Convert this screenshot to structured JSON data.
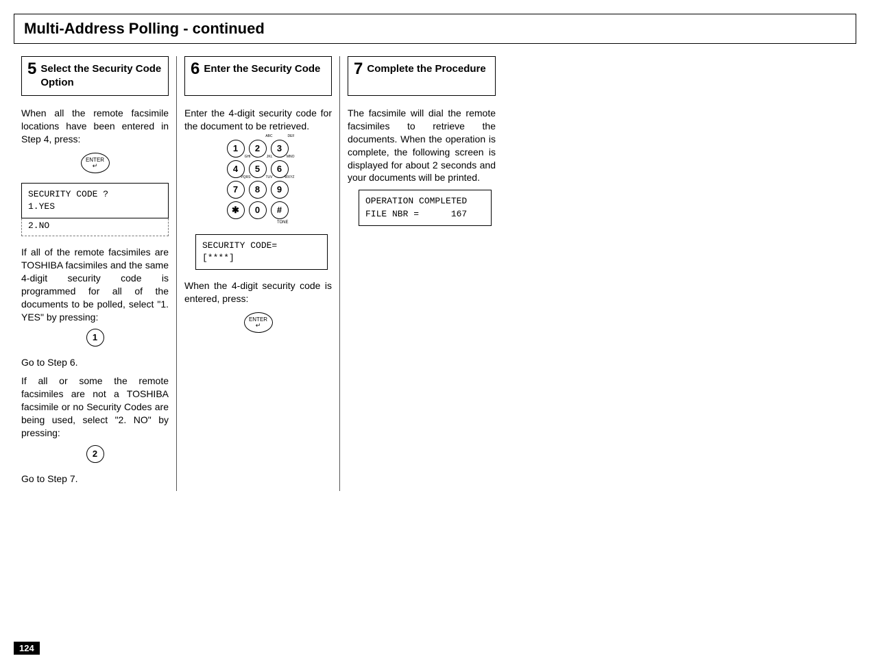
{
  "page_title": "Multi-Address Polling - continued",
  "page_number": "124",
  "step5": {
    "num": "5",
    "title": "Select the Security Code Option",
    "para1": "When all the remote facsimile locations have been entered in Step 4, press:",
    "enter_label": "ENTER",
    "screen1_line1": "SECURITY CODE ?",
    "screen1_line2": "1.YES",
    "screen1_line3": "2.NO",
    "para2": "If all of the remote facsimiles are TOSHIBA facsimiles and the same 4-digit security code is programmed for all of the documents to be polled, select \"1. YES\" by pressing:",
    "key_yes": "1",
    "para3": "Go to Step 6.",
    "para4": "If all or some the remote facsimiles are not a TOSHIBA facsimile or no Security Codes are being used, select \"2. NO\" by pressing:",
    "key_no": "2",
    "para5": "Go to Step 7."
  },
  "step6": {
    "num": "6",
    "title": "Enter the Security Code",
    "para1": "Enter the 4-digit security code for the document to be retrieved.",
    "keypad": {
      "k1": "1",
      "k2": "2",
      "k2s": "ABC",
      "k3": "3",
      "k3s": "DEF",
      "k4": "4",
      "k4s": "GHI",
      "k5": "5",
      "k5s": "JKL",
      "k6": "6",
      "k6s": "MNO",
      "k7": "7",
      "k7s": "PQRS",
      "k8": "8",
      "k8s": "TUV",
      "k9": "9",
      "k9s": "WXYZ",
      "ks": "✱",
      "k0": "0",
      "kh": "#",
      "tone": "TONE"
    },
    "screen_line1": "SECURITY CODE=",
    "screen_line2": "[****]",
    "para2": "When the 4-digit security code is entered, press:",
    "enter_label": "ENTER"
  },
  "step7": {
    "num": "7",
    "title": "Complete the Procedure",
    "para1": "The facsimile will dial the remote facsimiles to retrieve the documents. When the operation is complete, the following screen is displayed for about 2 seconds and your documents will be printed.",
    "screen_line1": "OPERATION COMPLETED",
    "screen_line2": "FILE NBR =      167"
  }
}
